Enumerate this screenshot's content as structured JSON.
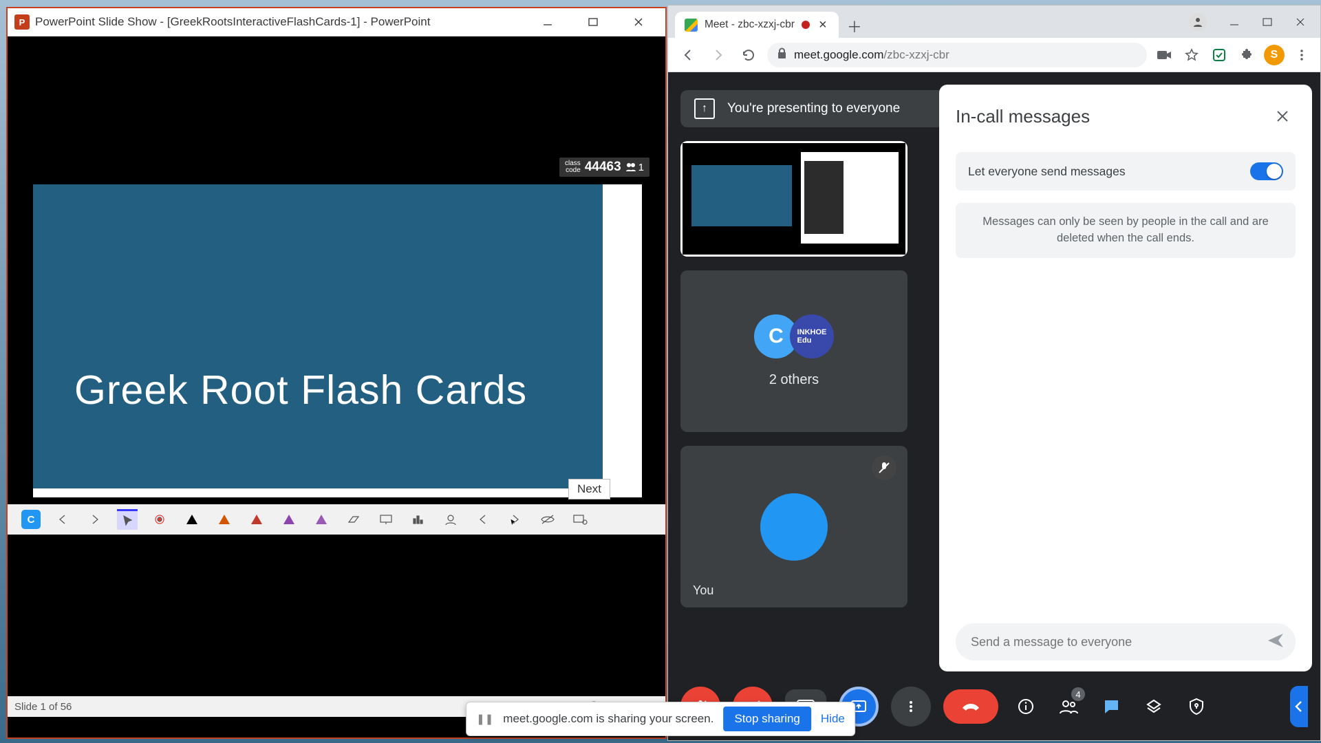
{
  "powerpoint": {
    "titlebar": "PowerPoint Slide Show - [GreekRootsInteractiveFlashCards-1] - PowerPoint",
    "slide_title": "Greek Root Flash Cards",
    "class_code_label_top": "class",
    "class_code_label_bot": "code",
    "class_code_value": "44463",
    "class_people": "1",
    "tooltip_next": "Next",
    "status": "Slide 1 of 56"
  },
  "chrome": {
    "tab_title": "Meet - zbc-xzxj-cbr",
    "url_host": "meet.google.com",
    "url_path": "/zbc-xzxj-cbr",
    "avatar_initial": "S"
  },
  "meet": {
    "presenting_text": "You're presenting to everyone",
    "others_label": "2 others",
    "you_label": "You",
    "people_badge": "4",
    "chat_title": "In-call messages",
    "toggle_label": "Let everyone send messages",
    "note_text": "Messages can only be seen by people in the call and are deleted when the call ends.",
    "chat_placeholder": "Send a message to everyone"
  },
  "share_toast": {
    "text": "meet.google.com is sharing your screen.",
    "stop": "Stop sharing",
    "hide": "Hide"
  }
}
